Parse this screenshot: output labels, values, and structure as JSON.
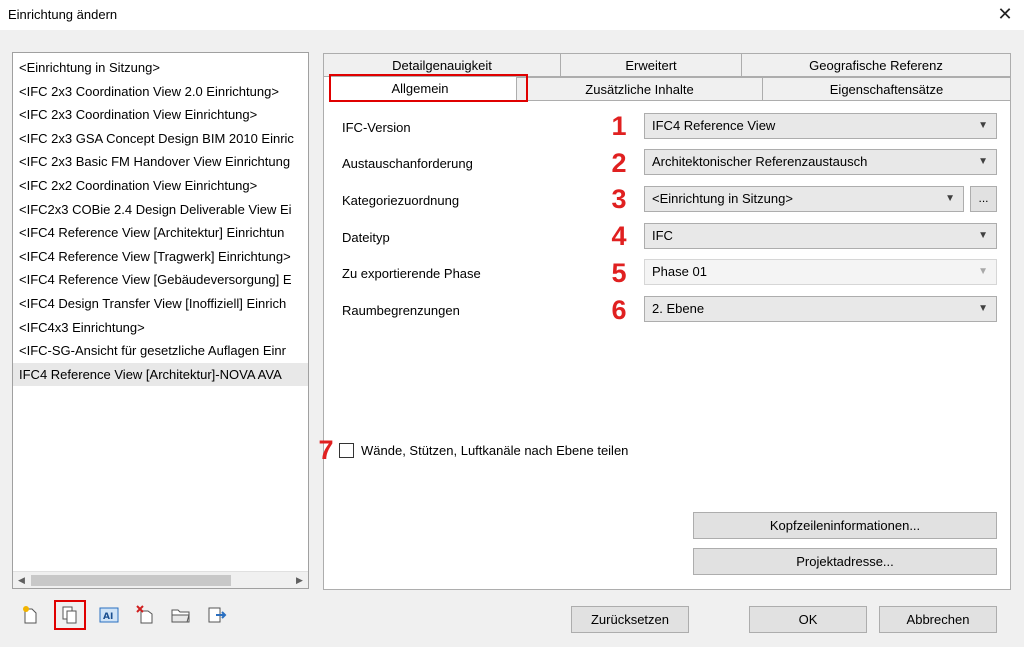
{
  "window": {
    "title": "Einrichtung ändern",
    "close_symbol": "✕"
  },
  "setup_list": {
    "items": [
      "<Einrichtung in Sitzung>",
      "<IFC 2x3 Coordination View 2.0 Einrichtung>",
      "<IFC 2x3 Coordination View Einrichtung>",
      "<IFC 2x3 GSA Concept Design BIM 2010 Einric",
      "<IFC 2x3 Basic FM Handover View Einrichtung",
      "<IFC 2x2 Coordination View Einrichtung>",
      "<IFC2x3 COBie 2.4 Design Deliverable View Ei",
      "<IFC4 Reference View [Architektur] Einrichtun",
      "<IFC4 Reference View [Tragwerk] Einrichtung>",
      "<IFC4 Reference View [Gebäudeversorgung] E",
      "<IFC4 Design Transfer View [Inoffiziell] Einrich",
      "<IFC4x3 Einrichtung>",
      "<IFC-SG-Ansicht für gesetzliche Auflagen Einr",
      "IFC4 Reference View [Architektur]-NOVA AVA"
    ],
    "selected_index": 13
  },
  "toolbar": {
    "icons": [
      "new-setup-icon",
      "duplicate-setup-icon",
      "rename-setup-icon",
      "delete-setup-icon",
      "import-setup-icon",
      "export-setup-icon"
    ]
  },
  "tabs": {
    "row1": [
      "Detailgenauigkeit",
      "Erweitert",
      "Geografische Referenz"
    ],
    "row2": [
      "Allgemein",
      "Zusätzliche Inhalte",
      "Eigenschaftensätze"
    ],
    "active": "Allgemein"
  },
  "fields": [
    {
      "label": "IFC-Version",
      "number": "1",
      "value": "IFC4 Reference View"
    },
    {
      "label": "Austauschanforderung",
      "number": "2",
      "value": "Architektonischer Referenzaustausch"
    },
    {
      "label": "Kategoriezuordnung",
      "number": "3",
      "value": "<Einrichtung in Sitzung>",
      "button": "..."
    },
    {
      "label": "Dateityp",
      "number": "4",
      "value": "IFC"
    },
    {
      "label": "Zu exportierende Phase",
      "number": "5",
      "value": "Phase 01",
      "disabled": true
    },
    {
      "label": "Raumbegrenzungen",
      "number": "6",
      "value": "2. Ebene"
    }
  ],
  "split_option": {
    "number": "7",
    "label": "Wände, Stützen, Luftkanäle nach Ebene teilen",
    "checked": false
  },
  "buttons": {
    "header_info": "Kopfzeileninformationen...",
    "project_address": "Projektadresse...",
    "reset": "Zurücksetzen",
    "ok": "OK",
    "cancel": "Abbrechen"
  },
  "colors": {
    "highlight": "#e00000",
    "annotation_number": "#e02020"
  }
}
